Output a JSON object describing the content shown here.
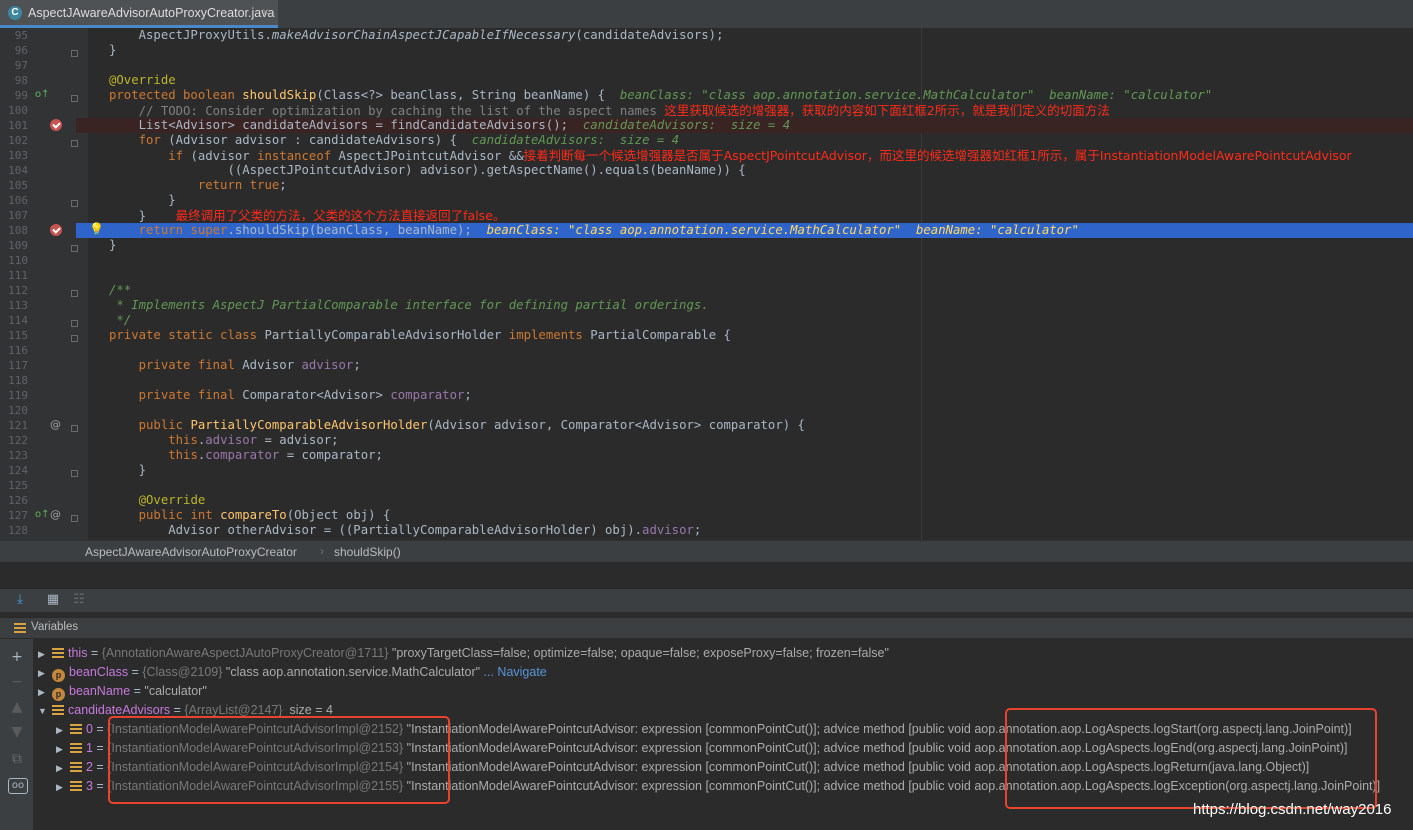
{
  "tab": {
    "icon": "C",
    "title": "AspectJAwareAdvisorAutoProxyCreator.java",
    "close": "×"
  },
  "code": {
    "lines": [
      {
        "n": "95",
        "html": "    AspectJProxyUtils.<span class='it'>makeAdvisorChainAspectJCapableIfNecessary</span>(candidateAdvisors);"
      },
      {
        "n": "96",
        "html": "}"
      },
      {
        "n": "97",
        "html": ""
      },
      {
        "n": "98",
        "html": "<span class='ann'>@Override</span>"
      },
      {
        "n": "99",
        "html": "<span class='kw'>protected boolean </span><span class='fn'>shouldSkip</span>(Class&lt;?&gt; beanClass, String beanName) {  <span class='hint'>beanClass: \"class aop.annotation.service.MathCalculator\"  beanName: \"calculator\"</span>"
      },
      {
        "n": "100",
        "html": "    <span class='cmt'>// TODO: Consider optimization by caching the list of the aspect names </span><span class='cn'>这里获取候选的增强器，获取的内容如下面红框2所示，就是我们定义的切面方法</span>"
      },
      {
        "n": "101",
        "html": "    List&lt;Advisor&gt; candidateAdvisors = findCandidateAdvisors();  <span class='hint'>candidateAdvisors:  size = 4</span>"
      },
      {
        "n": "102",
        "html": "    <span class='kw'>for </span>(Advisor advisor : candidateAdvisors) {  <span class='hint'>candidateAdvisors:  size = 4</span>"
      },
      {
        "n": "103",
        "html": "        <span class='kw'>if </span>(advisor <span class='kw'>instanceof </span>AspectJPointcutAdvisor &amp;&amp;<span class='cn'>接着判断每一个候选增强器是否属于AspectJPointcutAdvisor，而这里的候选增强器如红框1所示，属于InstantiationModelAwarePointcutAdvisor</span>"
      },
      {
        "n": "104",
        "html": "                ((AspectJPointcutAdvisor) advisor).getAspectName().equals(beanName)) {"
      },
      {
        "n": "105",
        "html": "            <span class='kw'>return true</span>;"
      },
      {
        "n": "106",
        "html": "        }"
      },
      {
        "n": "107",
        "html": "    }    <span class='cn'>最终调用了父类的方法，父类的这个方法直接返回了false。</span>"
      },
      {
        "n": "108",
        "html": "    <span class='kw'>return super</span>.shouldSkip(beanClass, beanName);  <span class='hintsel'>beanClass: \"class aop.annotation.service.MathCalculator\"  beanName: \"calculator\"</span>"
      },
      {
        "n": "109",
        "html": "}"
      },
      {
        "n": "110",
        "html": ""
      },
      {
        "n": "111",
        "html": ""
      },
      {
        "n": "112",
        "html": "<span class='doc'>/**</span>"
      },
      {
        "n": "113",
        "html": "<span class='doc'> * Implements AspectJ PartialComparable interface for defining partial orderings.</span>"
      },
      {
        "n": "114",
        "html": "<span class='doc'> */</span>"
      },
      {
        "n": "115",
        "html": "<span class='kw'>private static class </span>PartiallyComparableAdvisorHolder <span class='kw'>implements </span>PartialComparable {"
      },
      {
        "n": "116",
        "html": ""
      },
      {
        "n": "117",
        "html": "    <span class='kw'>private final </span>Advisor <span class='fld'>advisor</span>;"
      },
      {
        "n": "118",
        "html": ""
      },
      {
        "n": "119",
        "html": "    <span class='kw'>private final </span>Comparator&lt;Advisor&gt; <span class='fld'>comparator</span>;"
      },
      {
        "n": "120",
        "html": ""
      },
      {
        "n": "121",
        "html": "    <span class='kw'>public </span><span class='fn'>PartiallyComparableAdvisorHolder</span>(Advisor advisor, Comparator&lt;Advisor&gt; comparator) {"
      },
      {
        "n": "122",
        "html": "        <span class='kw'>this</span>.<span class='fld'>advisor </span>= advisor;"
      },
      {
        "n": "123",
        "html": "        <span class='kw'>this</span>.<span class='fld'>comparator </span>= comparator;"
      },
      {
        "n": "124",
        "html": "    }"
      },
      {
        "n": "125",
        "html": ""
      },
      {
        "n": "126",
        "html": "    <span class='ann'>@Override</span>"
      },
      {
        "n": "127",
        "html": "    <span class='kw'>public int </span><span class='fn'>compareTo</span>(Object obj) {"
      },
      {
        "n": "128",
        "html": "        Advisor otherAdvisor = ((PartiallyComparableAdvisorHolder) obj).<span class='fld'>advisor</span>;"
      }
    ]
  },
  "breadcrumb": {
    "class_name": "AspectJAwareAdvisorAutoProxyCreator",
    "separator": "›",
    "method": "shouldSkip()"
  },
  "debug": {
    "panel_title": "Variables",
    "variables": [
      {
        "expand": "▶",
        "kind": "field",
        "name": "this",
        "eq": " = ",
        "obj": "{AnnotationAwareAspectJAutoProxyCreator@1711}",
        "val": " \"proxyTargetClass=false; optimize=false; opaque=false; exposeProxy=false; frozen=false\"",
        "link": ""
      },
      {
        "expand": "▶",
        "kind": "param",
        "name": "beanClass",
        "eq": " = ",
        "obj": "{Class@2109}",
        "val": " \"class aop.annotation.service.MathCalculator\"",
        "link": " ... Navigate"
      },
      {
        "expand": "▶",
        "kind": "param",
        "name": "beanName",
        "eq": " = ",
        "obj": "",
        "val": "\"calculator\"",
        "link": ""
      },
      {
        "expand": "▼",
        "kind": "field",
        "name": "candidateAdvisors",
        "eq": " = ",
        "obj": "{ArrayList@2147}",
        "val": "  size = 4",
        "link": ""
      }
    ],
    "advisors": [
      {
        "idx": "0",
        "obj": "{InstantiationModelAwarePointcutAdvisorImpl@2152}",
        "val": " \"InstantiationModelAwarePointcutAdvisor: expression [commonPointCut()]; advice method [public void aop.annotation.aop.LogAspects.logStart(org.aspectj.lang.JoinPoint)]"
      },
      {
        "idx": "1",
        "obj": "{InstantiationModelAwarePointcutAdvisorImpl@2153}",
        "val": " \"InstantiationModelAwarePointcutAdvisor: expression [commonPointCut()]; advice method [public void aop.annotation.aop.LogAspects.logEnd(org.aspectj.lang.JoinPoint)]"
      },
      {
        "idx": "2",
        "obj": "{InstantiationModelAwarePointcutAdvisorImpl@2154}",
        "val": " \"InstantiationModelAwarePointcutAdvisor: expression [commonPointCut()]; advice method [public void aop.annotation.aop.LogAspects.logReturn(java.lang.Object)]"
      },
      {
        "idx": "3",
        "obj": "{InstantiationModelAwarePointcutAdvisorImpl@2155}",
        "val": " \"InstantiationModelAwarePointcutAdvisor: expression [commonPointCut()]; advice method [public void aop.annotation.aop.LogAspects.logException(org.aspectj.lang.JoinPoint)]"
      }
    ]
  },
  "watermark": "https://blog.csdn.net/way2016"
}
